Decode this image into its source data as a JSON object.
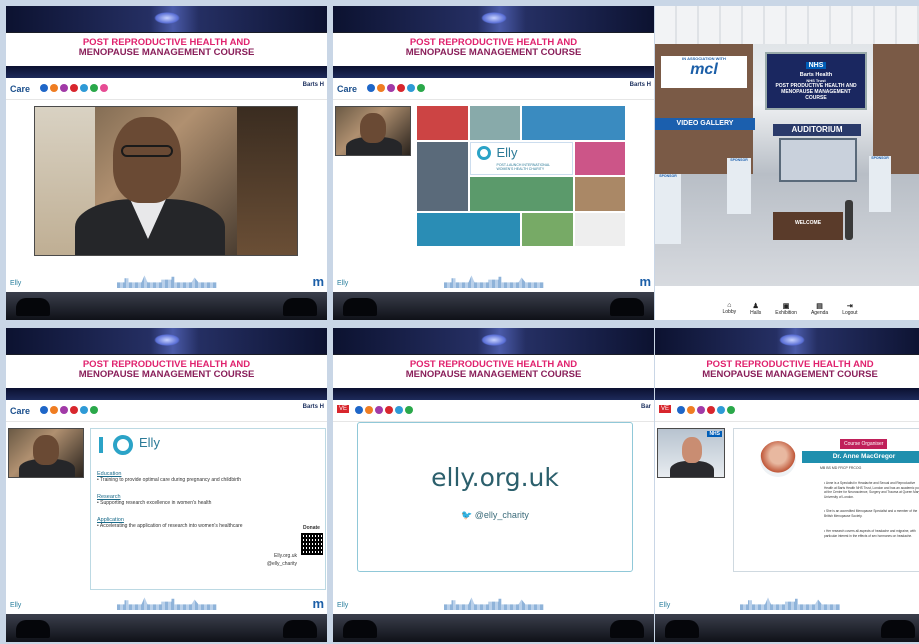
{
  "course_title": {
    "line1": "POST REPRODUCTIVE HEALTH AND",
    "line2": "MENOPAUSE MANAGEMENT COURSE"
  },
  "header": {
    "care": "Care",
    "barts": "Barts H",
    "barts_alt": "Bar"
  },
  "footer": {
    "elly": "Elly",
    "m": "m"
  },
  "tile_colors": [
    "#1e66c8",
    "#ef7d22",
    "#a13aa7",
    "#d8262d",
    "#2e9ad6",
    "#2aa84a",
    "#e64c94"
  ],
  "tile2": {
    "elly": "Elly",
    "elly_sub": "POST-LAUNCH INTERNATIONAL WOMEN'S HEALTH CHARITY"
  },
  "lobby": {
    "association": "IN ASSOCIATION WITH",
    "mcl": "mcl",
    "nhs": "NHS",
    "nhs_trust": "Barts Health",
    "nhs_trust2": "NHS Trust",
    "course": "POST PRODUCTIVE HEALTH AND MENOPAUSE MANAGEMENT COURSE",
    "video_gallery": "VIDEO GALLERY",
    "auditorium": "AUDITORIUM",
    "welcome": "WELCOME",
    "sponsor": "SPONSOR",
    "menu": [
      "Lobby",
      "Halls",
      "Exhibition",
      "Agenda",
      "Logout"
    ]
  },
  "tile4": {
    "elly": "Elly",
    "sections": [
      {
        "h": "Education",
        "t": "• Training to provide optimal care during pregnancy and childbirth"
      },
      {
        "h": "Research",
        "t": "• Supporting research excellence in women's health"
      },
      {
        "h": "Application",
        "t": "• Accelerating the application of research into women's healthcare"
      }
    ],
    "site": "Elly.org.uk",
    "handle": "@elly_charity",
    "donate": "Donate"
  },
  "tile5": {
    "url": "elly.org.uk",
    "twitter": "@elly_charity",
    "hdr_badge": "VE"
  },
  "tile6": {
    "badge": "Course Organiser",
    "name": "Dr. Anne MacGregor",
    "creds": "MB BS MD FRCP FRCOG",
    "b1": "• Anne is a Specialist in Headache and Sexual and Reproductive Health at Barts Health NHS Trust, London and has an academic post at the Centre for Neuroscience, Surgery and Trauma at Queen Mary, University of London.",
    "b2": "• She is an accredited Menopause Specialist and a member of the British Menopause Society.",
    "b3": "• Her research covers all aspects of headache and migraine, with particular interest in the effects of sex hormones on headache.",
    "nhs": "NHS",
    "hdr_badge": "VE"
  }
}
